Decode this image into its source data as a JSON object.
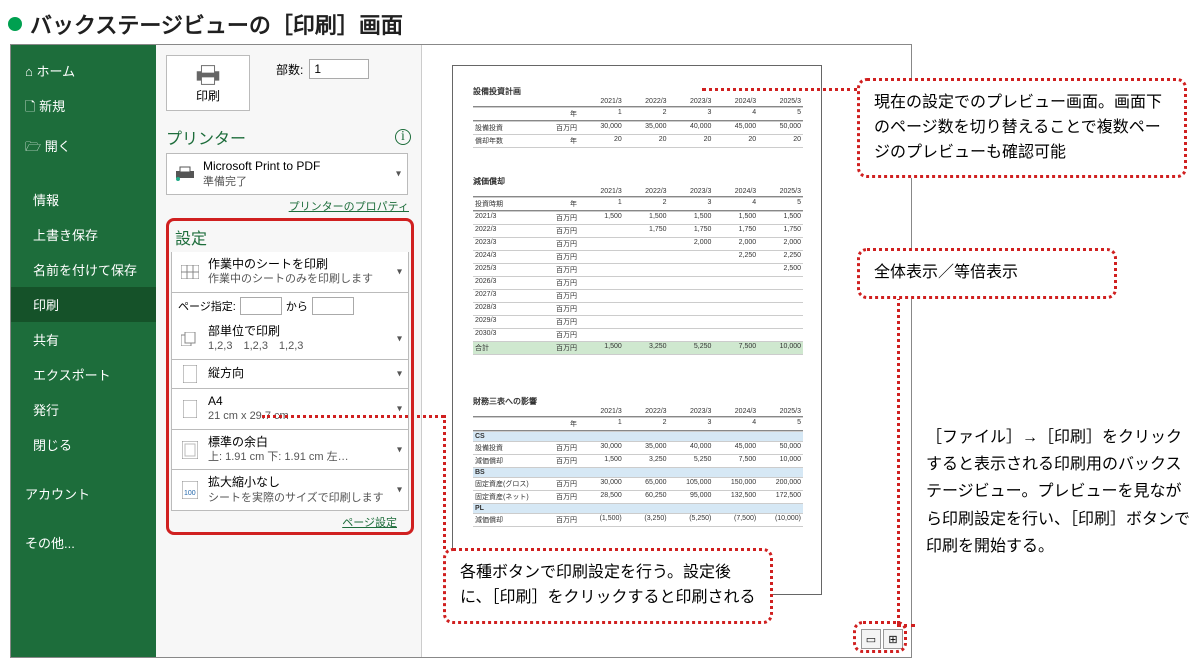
{
  "title": "バックステージビューの［印刷］画面",
  "sidebar": {
    "items": [
      {
        "label": "ホーム",
        "icon": "home"
      },
      {
        "label": "新規",
        "icon": "new"
      },
      {
        "label": "開く",
        "icon": "open"
      },
      {
        "label": "情報"
      },
      {
        "label": "上書き保存"
      },
      {
        "label": "名前を付けて保存"
      },
      {
        "label": "印刷",
        "active": true
      },
      {
        "label": "共有"
      },
      {
        "label": "エクスポート"
      },
      {
        "label": "発行"
      },
      {
        "label": "閉じる"
      },
      {
        "label": "アカウント"
      },
      {
        "label": "その他..."
      }
    ]
  },
  "print": {
    "button_label": "印刷",
    "copies_label": "部数:",
    "copies_value": "1"
  },
  "printer": {
    "heading": "プリンター",
    "name": "Microsoft Print to PDF",
    "status": "準備完了",
    "properties_link": "プリンターのプロパティ"
  },
  "settings": {
    "heading": "設定",
    "print_what": {
      "main": "作業中のシートを印刷",
      "sub": "作業中のシートのみを印刷します"
    },
    "page_label": "ページ指定:",
    "page_to": "から",
    "collate": {
      "main": "部単位で印刷",
      "sub": "1,2,3　1,2,3　1,2,3"
    },
    "orientation": {
      "main": "縦方向"
    },
    "paper": {
      "main": "A4",
      "sub": "21 cm x 29.7 cm"
    },
    "margins": {
      "main": "標準の余白",
      "sub": "上: 1.91 cm 下: 1.91 cm 左…"
    },
    "scaling": {
      "main": "拡大縮小なし",
      "sub": "シートを実際のサイズで印刷します"
    },
    "page_setup_link": "ページ設定"
  },
  "callouts": {
    "c1": "現在の設定でのプレビュー画面。画面下のページ数を切り替えることで複数ページのプレビューも確認可能",
    "c2": "全体表示／等倍表示",
    "c3": "各種ボタンで印刷設定を行う。設定後に、［印刷］をクリックすると印刷される"
  },
  "desc_right": "［ファイル］→［印刷］をクリックすると表示される印刷用のバックステージビュー。プレビューを見ながら印刷設定を行い、［印刷］ボタンで印刷を開始する。",
  "sheet": {
    "s1": {
      "title": "設備投資計画",
      "years": [
        "",
        "",
        "2021/3",
        "2022/3",
        "2023/3",
        "2024/3",
        "2025/3"
      ],
      "nums": [
        "",
        "年",
        "1",
        "2",
        "3",
        "4",
        "5"
      ],
      "rows": [
        [
          "設備投資",
          "百万円",
          "30,000",
          "35,000",
          "40,000",
          "45,000",
          "50,000"
        ],
        [
          "償却年数",
          "年",
          "20",
          "20",
          "20",
          "20",
          "20"
        ]
      ]
    },
    "s2": {
      "title": "減価償却",
      "years": [
        "",
        "",
        "2021/3",
        "2022/3",
        "2023/3",
        "2024/3",
        "2025/3"
      ],
      "nums": [
        "投資時期",
        "年",
        "1",
        "2",
        "3",
        "4",
        "5"
      ],
      "rows": [
        [
          "2021/3",
          "百万円",
          "1,500",
          "1,500",
          "1,500",
          "1,500",
          "1,500"
        ],
        [
          "2022/3",
          "百万円",
          "",
          "1,750",
          "1,750",
          "1,750",
          "1,750"
        ],
        [
          "2023/3",
          "百万円",
          "",
          "",
          "2,000",
          "2,000",
          "2,000"
        ],
        [
          "2024/3",
          "百万円",
          "",
          "",
          "",
          "2,250",
          "2,250"
        ],
        [
          "2025/3",
          "百万円",
          "",
          "",
          "",
          "",
          "2,500"
        ],
        [
          "2026/3",
          "百万円",
          "",
          "",
          "",
          "",
          ""
        ],
        [
          "2027/3",
          "百万円",
          "",
          "",
          "",
          "",
          ""
        ],
        [
          "2028/3",
          "百万円",
          "",
          "",
          "",
          "",
          ""
        ],
        [
          "2029/3",
          "百万円",
          "",
          "",
          "",
          "",
          ""
        ],
        [
          "2030/3",
          "百万円",
          "",
          "",
          "",
          "",
          ""
        ],
        [
          "合計",
          "百万円",
          "1,500",
          "3,250",
          "5,250",
          "7,500",
          "10,000"
        ]
      ]
    },
    "s3": {
      "title": "財務三表への影響",
      "years": [
        "",
        "",
        "2021/3",
        "2022/3",
        "2023/3",
        "2024/3",
        "2025/3"
      ],
      "nums": [
        "",
        "年",
        "1",
        "2",
        "3",
        "4",
        "5"
      ],
      "groups": [
        {
          "h": "CS",
          "rows": [
            [
              "設備投資",
              "百万円",
              "30,000",
              "35,000",
              "40,000",
              "45,000",
              "50,000"
            ],
            [
              "減価償却",
              "百万円",
              "1,500",
              "3,250",
              "5,250",
              "7,500",
              "10,000"
            ]
          ]
        },
        {
          "h": "BS",
          "rows": [
            [
              "固定資産(グロス)",
              "百万円",
              "30,000",
              "65,000",
              "105,000",
              "150,000",
              "200,000"
            ],
            [
              "固定資産(ネット)",
              "百万円",
              "28,500",
              "60,250",
              "95,000",
              "132,500",
              "172,500"
            ]
          ]
        },
        {
          "h": "PL",
          "rows": [
            [
              "減価償却",
              "百万円",
              "(1,500)",
              "(3,250)",
              "(5,250)",
              "(7,500)",
              "(10,000)"
            ]
          ]
        }
      ]
    }
  }
}
